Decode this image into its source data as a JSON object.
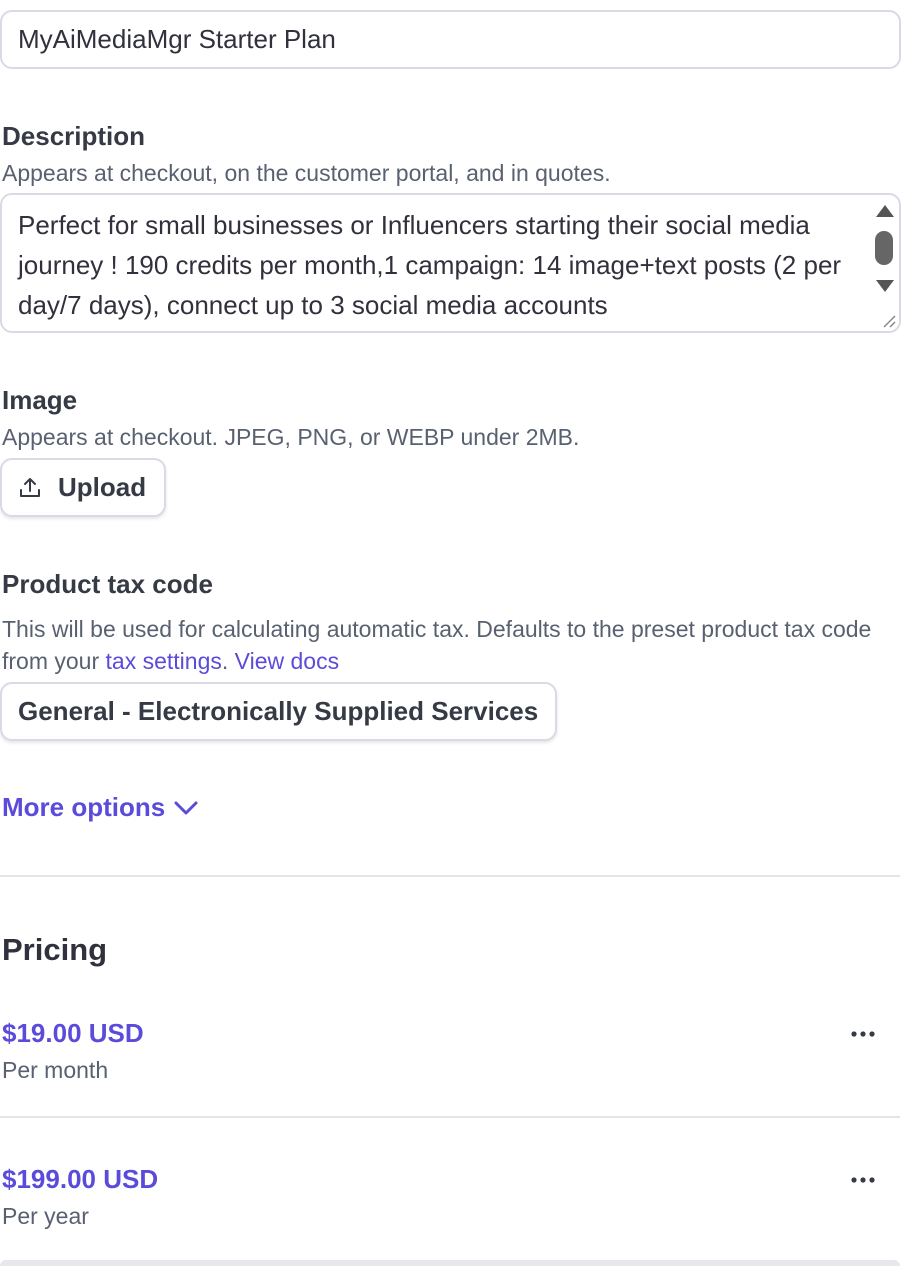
{
  "name_field": {
    "value": "MyAiMediaMgr Starter Plan"
  },
  "description": {
    "label": "Description",
    "help": "Appears at checkout, on the customer portal, and in quotes.",
    "value": "Perfect for small businesses or Influencers starting their social media journey ! 190 credits per month,1 campaign: 14 image+text posts (2 per day/7 days), connect up to 3 social media accounts"
  },
  "image": {
    "label": "Image",
    "help": "Appears at checkout. JPEG, PNG, or WEBP under 2MB.",
    "upload_label": "Upload",
    "icon": "upload-icon"
  },
  "tax_code": {
    "label": "Product tax code",
    "help_prefix": "This will be used for calculating automatic tax. Defaults to the preset product tax code from your ",
    "tax_settings_link": "tax settings",
    "separator": ".",
    "view_docs_link": "View docs",
    "selected_value": "General - Electronically Supplied Services"
  },
  "more_options": {
    "label": "More options",
    "icon": "chevron-down-icon"
  },
  "pricing": {
    "title": "Pricing",
    "prices": [
      {
        "amount": "$19.00 USD",
        "interval": "Per month"
      },
      {
        "amount": "$199.00 USD",
        "interval": "Per year"
      }
    ]
  },
  "colors": {
    "accent": "#5b4bdb",
    "text": "#30313d",
    "muted": "#596171",
    "border": "#d8dbe3"
  }
}
